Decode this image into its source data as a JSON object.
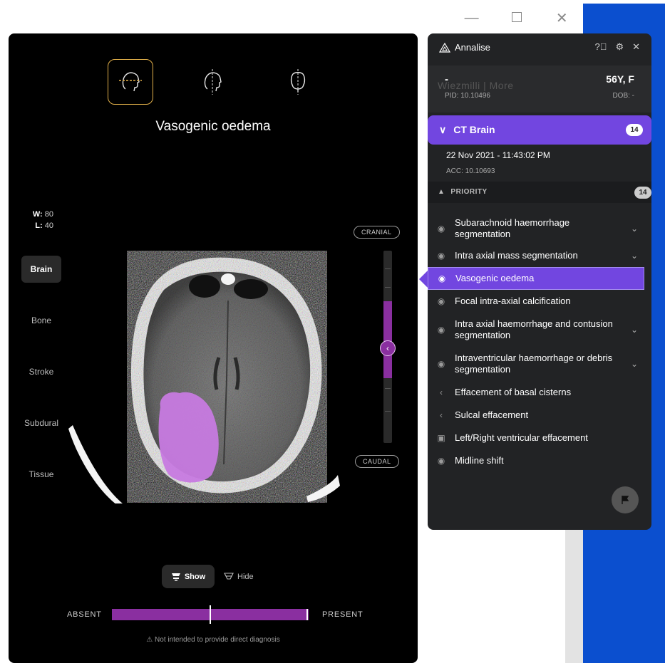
{
  "window": {
    "minimize": "—",
    "close": "✕"
  },
  "viewer": {
    "finding_title": "Vasogenic oedema",
    "wl": {
      "w_label": "W:",
      "w_value": "80",
      "l_label": "L:",
      "l_value": "40"
    },
    "presets": [
      {
        "label": "Brain",
        "active": true
      },
      {
        "label": "Bone",
        "active": false
      },
      {
        "label": "Stroke",
        "active": false
      },
      {
        "label": "Subdural",
        "active": false
      },
      {
        "label": "Tissue",
        "active": false
      }
    ],
    "cranial": "CRANIAL",
    "caudal": "CAUDAL",
    "slice_position": 0.49,
    "show_label": "Show",
    "hide_label": "Hide",
    "confidence": {
      "absent": "ABSENT",
      "present": "PRESENT",
      "threshold": 0.5,
      "value": 0.99
    },
    "disclaimer": "Not intended to provide direct diagnosis"
  },
  "panel": {
    "brand": "Annalise",
    "ghost_text": "Wiezmilli  |   More",
    "patient": {
      "name": "-",
      "pid": "PID: 10.10496",
      "age_sex": "56Y, F",
      "dob": "DOB: -"
    },
    "study": {
      "label": "CT Brain",
      "count": "14",
      "date": "22 Nov 2021 - 11:43:02 PM",
      "acc": "ACC: 10.10693"
    },
    "priority": {
      "label": "PRIORITY",
      "count": "14"
    },
    "findings": [
      {
        "label": "Subarachnoid haemorrhage segmentation",
        "icon": "eye-icon",
        "expandable": true
      },
      {
        "label": "Intra axial mass segmentation",
        "icon": "eye-icon",
        "expandable": true
      },
      {
        "label": "Vasogenic oedema",
        "icon": "eye-icon",
        "expandable": false,
        "active": true
      },
      {
        "label": "Focal intra-axial calcification",
        "icon": "eye-icon",
        "expandable": false
      },
      {
        "label": "Intra axial haemorrhage and contusion segmentation",
        "icon": "eye-icon",
        "expandable": true
      },
      {
        "label": "Intraventricular haemorrhage or debris segmentation",
        "icon": "eye-icon",
        "expandable": true
      },
      {
        "label": "Effacement of basal cisterns",
        "icon": "chevron-left-icon",
        "expandable": false
      },
      {
        "label": "Sulcal effacement",
        "icon": "chevron-left-icon",
        "expandable": false
      },
      {
        "label": "Left/Right ventricular effacement",
        "icon": "square-icon",
        "expandable": false
      },
      {
        "label": "Midline shift",
        "icon": "eye-icon",
        "expandable": false
      }
    ]
  },
  "colors": {
    "accent": "#7246e0",
    "overlay": "#8a2fa0",
    "selected_plane": "#e2b04a"
  }
}
